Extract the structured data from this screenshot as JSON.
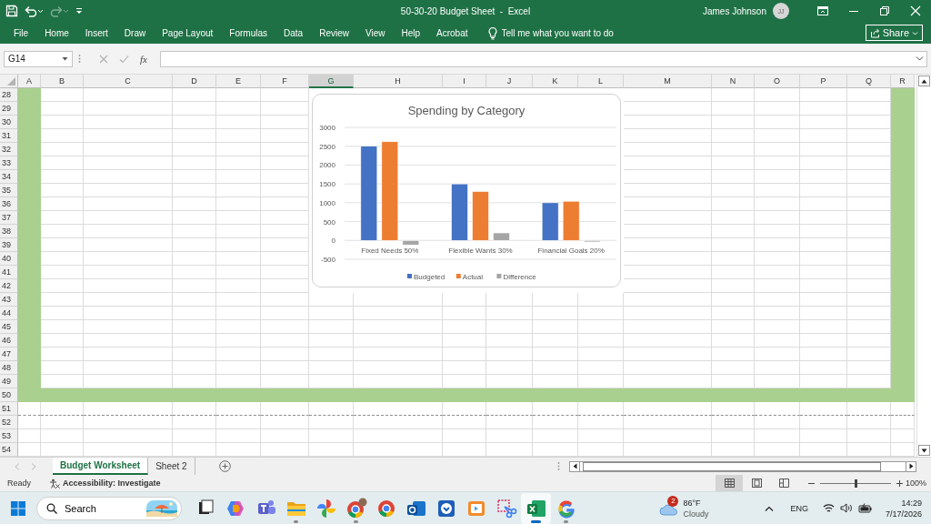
{
  "title_bar": {
    "quick_access": [
      {
        "kind": "save",
        "disabled": false
      },
      {
        "kind": "undo",
        "disabled": false
      },
      {
        "kind": "redo",
        "disabled": true
      },
      {
        "kind": "customize",
        "disabled": false
      }
    ],
    "title": "50-30-20 Budget Sheet  -  Excel",
    "user": "James Johnson",
    "avatar": "JJ"
  },
  "ribbon": {
    "tabs": [
      "File",
      "Home",
      "Insert",
      "Draw",
      "Page Layout",
      "Formulas",
      "Data",
      "Review",
      "View",
      "Help",
      "Acrobat"
    ],
    "tell_me": {
      "placeholder": "Tell me what you want to do"
    },
    "share": "Share"
  },
  "formula_bar": {
    "name_box": "G14",
    "cancel_disabled": true,
    "enter_disabled": true,
    "function_label": "fx"
  },
  "sheet": {
    "columns": [
      {
        "label": "A",
        "selected": false
      },
      {
        "label": "B",
        "selected": false
      },
      {
        "label": "C",
        "selected": false
      },
      {
        "label": "D",
        "selected": false
      },
      {
        "label": "E",
        "selected": false
      },
      {
        "label": "F",
        "selected": false
      },
      {
        "label": "G",
        "selected": true
      },
      {
        "label": "H",
        "selected": false
      },
      {
        "label": "I",
        "selected": false
      },
      {
        "label": "J",
        "selected": false
      },
      {
        "label": "K",
        "selected": false
      },
      {
        "label": "L",
        "selected": false
      },
      {
        "label": "M",
        "selected": false
      },
      {
        "label": "N",
        "selected": false
      },
      {
        "label": "O",
        "selected": false
      },
      {
        "label": "P",
        "selected": false
      },
      {
        "label": "Q",
        "selected": false
      },
      {
        "label": "R",
        "selected": false
      }
    ],
    "rows": [
      "28",
      "29",
      "30",
      "31",
      "32",
      "33",
      "34",
      "35",
      "36",
      "37",
      "38",
      "39",
      "40",
      "41",
      "42",
      "43",
      "44",
      "45",
      "46",
      "47",
      "48",
      "49",
      "50",
      "51",
      "52",
      "53",
      "54"
    ],
    "chart": {
      "chart_data": {
        "type": "bar",
        "title": "Spending by Category",
        "categories": [
          "Fixed Needs 50%",
          "Flexible Wants 30%",
          "Financial Goals 20%"
        ],
        "series": [
          {
            "name": "Budgeted",
            "color": "#4472c4",
            "values": [
              2500,
              1500,
              1000
            ]
          },
          {
            "name": "Actual",
            "color": "#ed7d31",
            "values": [
              2620,
              1300,
              1040
            ]
          },
          {
            "name": "Difference",
            "color": "#a5a5a5",
            "values": [
              -120,
              200,
              -40
            ]
          }
        ],
        "grid": true,
        "legend": true,
        "ylim": [
          -500,
          3000
        ],
        "yticks": [
          -500,
          0,
          500,
          1000,
          1500,
          2000,
          2500,
          3000
        ]
      }
    }
  },
  "sheet_tabs": [
    {
      "label": "Budget Worksheet",
      "selected": true
    },
    {
      "label": "Sheet 2",
      "selected": false
    }
  ],
  "status_bar": {
    "status": "Ready",
    "accessibility": "Accessibility: Investigate",
    "views": [
      {
        "kind": "normal",
        "selected": true
      },
      {
        "kind": "page-layout",
        "selected": false
      },
      {
        "kind": "page-break",
        "selected": false
      }
    ],
    "zoom": {
      "level": 0.5,
      "reading": "100%"
    }
  },
  "taskbar": {
    "search": {
      "placeholder": "Search"
    },
    "apps": [
      {
        "kind": "task-view",
        "running": false,
        "selected": false
      },
      {
        "kind": "copilot",
        "running": false,
        "selected": false
      },
      {
        "kind": "teams",
        "running": false,
        "selected": false
      },
      {
        "kind": "folder",
        "running": true,
        "selected": false
      },
      {
        "kind": "pinwheel",
        "running": false,
        "selected": false
      },
      {
        "kind": "browser-profile",
        "running": true,
        "selected": false
      },
      {
        "kind": "browser",
        "running": false,
        "selected": false
      },
      {
        "kind": "mail",
        "running": false,
        "selected": false
      },
      {
        "kind": "shield",
        "running": false,
        "selected": false
      },
      {
        "kind": "video",
        "running": false,
        "selected": false
      },
      {
        "kind": "snip",
        "running": false,
        "selected": false
      },
      {
        "kind": "excel",
        "running": true,
        "selected": true
      },
      {
        "kind": "google",
        "running": true,
        "selected": false
      }
    ],
    "weather": {
      "badge": "2",
      "temperature": "86°F",
      "condition": "Cloudy"
    },
    "language": "ENG",
    "time": "14:29",
    "date": "7/17/2026"
  }
}
